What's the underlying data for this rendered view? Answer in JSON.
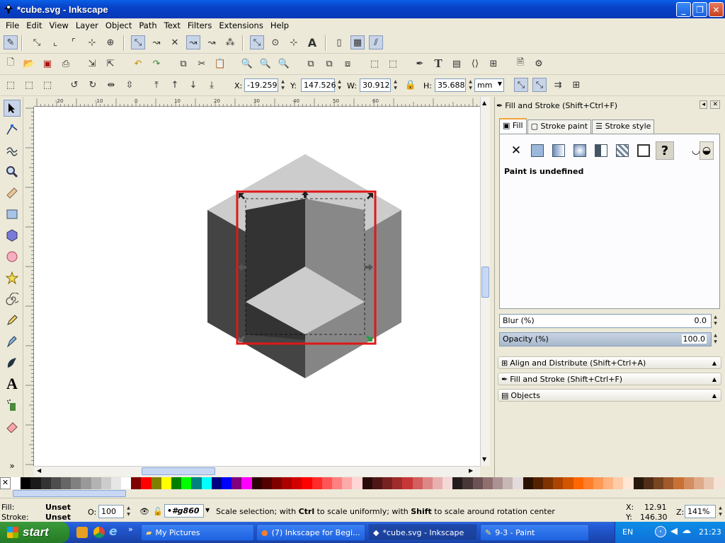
{
  "window": {
    "title": "*cube.svg - Inkscape",
    "buttons": {
      "minimize": "_",
      "maximize": "❐",
      "close": "✕"
    }
  },
  "menu": [
    "File",
    "Edit",
    "View",
    "Layer",
    "Object",
    "Path",
    "Text",
    "Filters",
    "Extensions",
    "Help"
  ],
  "controls": {
    "x_label": "X:",
    "x_value": "-19.259",
    "y_label": "Y:",
    "y_value": "147.526",
    "w_label": "W:",
    "w_value": "30.912",
    "h_label": "H:",
    "h_value": "35.688",
    "unit": "mm"
  },
  "ruler": {
    "h_ticks": [
      "-20",
      "-10",
      "0",
      "10",
      "20",
      "30",
      "40",
      "50",
      "60"
    ]
  },
  "dock": {
    "title": "Fill and Stroke (Shift+Ctrl+F)",
    "tabs": [
      "Fill",
      "Stroke paint",
      "Stroke style"
    ],
    "paint_status": "Paint is undefined",
    "blur_label": "Blur (%)",
    "blur_value": "0.0",
    "opacity_label": "Opacity (%)",
    "opacity_value": "100.0",
    "expanders": [
      "Align and Distribute (Shift+Ctrl+A)",
      "Fill and Stroke (Shift+Ctrl+F)",
      "Objects"
    ]
  },
  "status": {
    "fill_label": "Fill:",
    "fill_value": "Unset",
    "stroke_label": "Stroke:",
    "stroke_value": "Unset",
    "opacity_label": "O:",
    "opacity_value": "100",
    "layer_value": "#g860",
    "message_parts": [
      "Scale selection; with ",
      "Ctrl",
      " to scale uniformly; with ",
      "Shift",
      " to scale around rotation center"
    ],
    "x_label": "X:",
    "x_value": "12.91",
    "y_label": "Y:",
    "y_value": "146.30",
    "zoom_label": "Z:",
    "zoom_value": "141%"
  },
  "taskbar": {
    "start": "start",
    "tasks": [
      "My Pictures",
      "(7) Inkscape for Begi...",
      "*cube.svg - Inkscape",
      "9-3 - Paint"
    ],
    "lang": "EN",
    "clock": "21:23"
  },
  "colors": {
    "selection_box": "#e01818",
    "cube_top": "#cccccc",
    "cube_left": "#444444",
    "cube_right": "#858585",
    "inner_left": "#333333",
    "inner_right": "#888888"
  }
}
